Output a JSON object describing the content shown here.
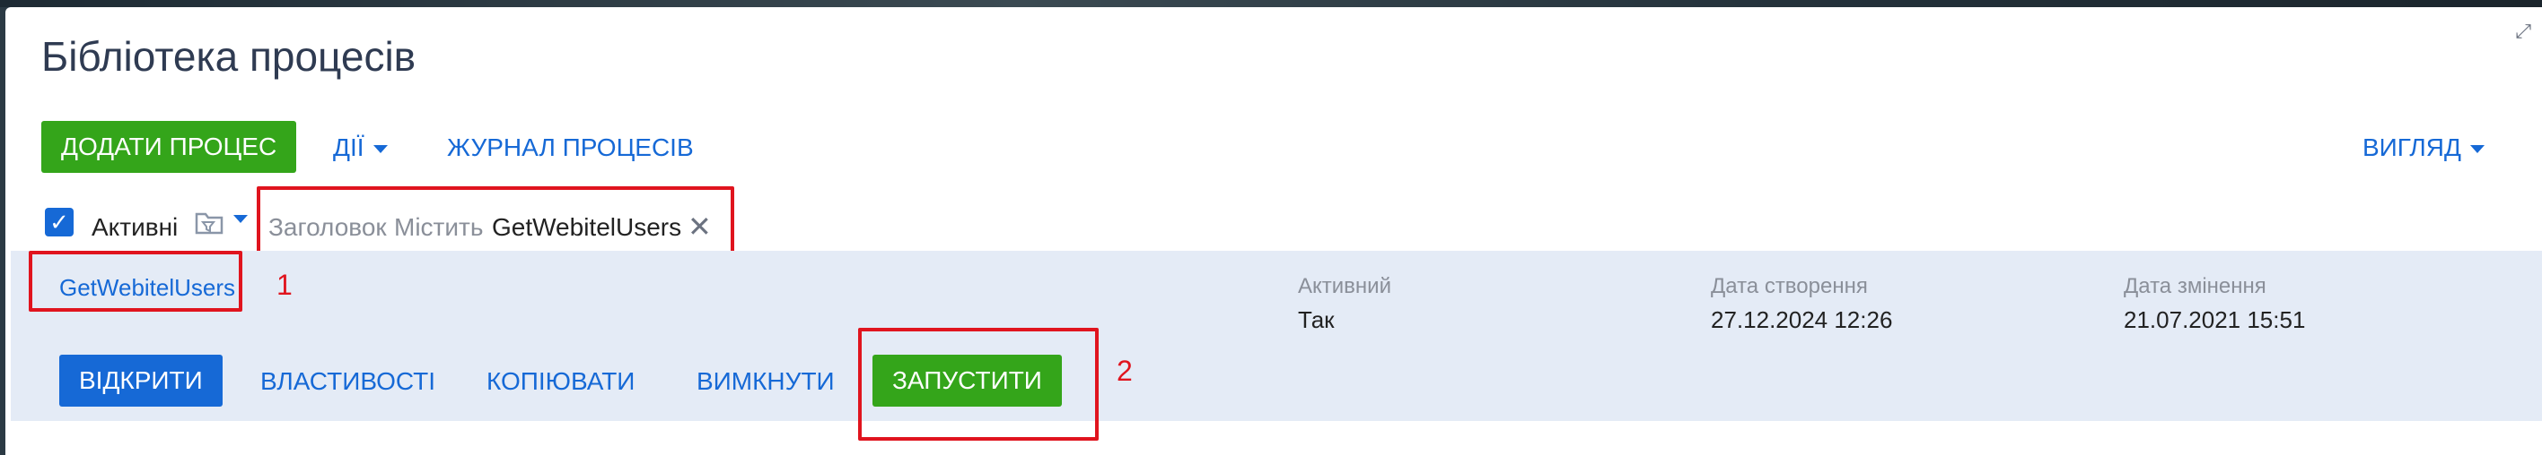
{
  "page": {
    "title": "Бібліотека процесів"
  },
  "toolbar": {
    "add_process": "ДОДАТИ ПРОЦЕС",
    "actions": "ДІЇ",
    "process_log": "ЖУРНАЛ ПРОЦЕСІВ",
    "view": "ВИГЛЯД"
  },
  "filters": {
    "active_label": "Активні",
    "active_checked": true,
    "tag": {
      "field": "Заголовок",
      "operator": "Містить",
      "value": "GetWebitelUsers"
    }
  },
  "row": {
    "name": "GetWebitelUsers",
    "columns": [
      {
        "header": "Активний",
        "value": "Так"
      },
      {
        "header": "Дата створення",
        "value": "27.12.2024 12:26"
      },
      {
        "header": "Дата змінення",
        "value": "21.07.2021 15:51"
      }
    ],
    "actions": {
      "open": "ВІДКРИТИ",
      "properties": "ВЛАСТИВОСТІ",
      "copy": "КОПІЮВАТИ",
      "disable": "ВИМКНУТИ",
      "run": "ЗАПУСТИТИ"
    }
  },
  "annotations": {
    "first": "1",
    "second": "2"
  },
  "colors": {
    "accent_blue": "#1669d6",
    "green": "#34a51a",
    "highlight_red": "#e0141e",
    "row_bg": "#e4ebf6"
  },
  "icons": [
    "expand-icon",
    "filter-folder-icon",
    "close-icon",
    "chevron-down-icon",
    "check-icon"
  ]
}
